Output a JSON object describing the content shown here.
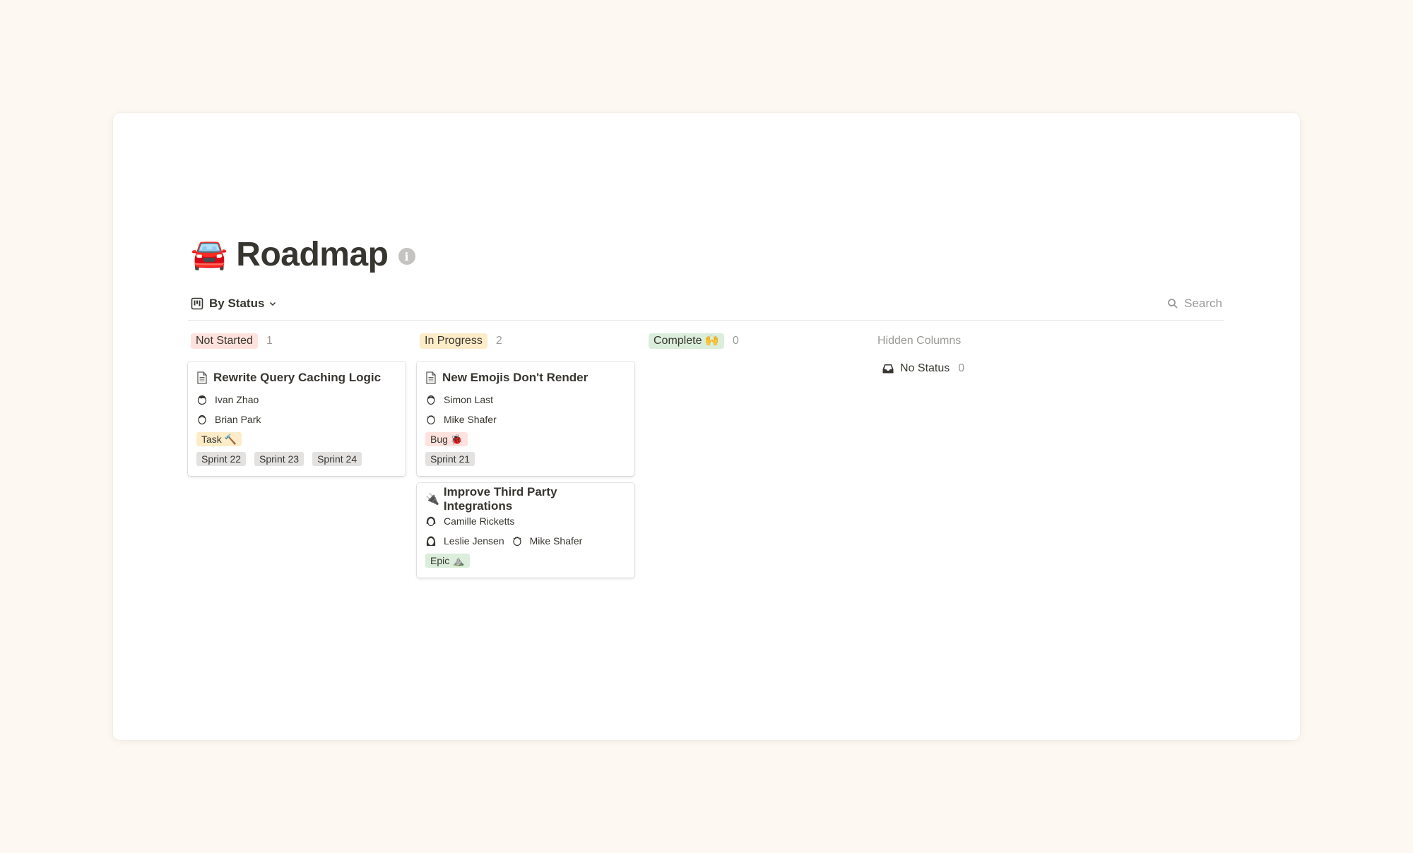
{
  "page": {
    "emoji": "🚘",
    "title": "Roadmap",
    "info_icon": "i"
  },
  "toolbar": {
    "view_icon": "board-icon",
    "view_label": "By Status",
    "search_label": "Search"
  },
  "columns": [
    {
      "label": "Not Started",
      "count": "1",
      "color": "#ffe2dd",
      "cards": [
        {
          "icon": "document-icon",
          "title": "Rewrite Query Caching Logic",
          "people": [
            [
              "Ivan Zhao"
            ],
            [
              "Brian Park"
            ]
          ],
          "type_tag": {
            "label": "Task 🔨",
            "color": "#fdecc8"
          },
          "sprints": [
            "Sprint 22",
            "Sprint 23",
            "Sprint 24"
          ]
        }
      ]
    },
    {
      "label": "In Progress",
      "count": "2",
      "color": "#fdecc8",
      "cards": [
        {
          "icon": "document-icon",
          "title": "New Emojis Don't Render",
          "people": [
            [
              "Simon Last"
            ],
            [
              "Mike Shafer"
            ]
          ],
          "type_tag": {
            "label": "Bug 🐞",
            "color": "#ffe2dd"
          },
          "sprints": [
            "Sprint 21"
          ]
        },
        {
          "icon": "plug-icon",
          "title": "Improve Third Party Integrations",
          "people": [
            [
              "Camille Ricketts"
            ],
            [
              "Leslie Jensen",
              "Mike Shafer"
            ]
          ],
          "type_tag": {
            "label": "Epic ⛰️",
            "color": "#dbeddb"
          },
          "sprints": []
        }
      ]
    },
    {
      "label": "Complete 🙌",
      "count": "0",
      "color": "#dbeddb",
      "cards": []
    }
  ],
  "hidden": {
    "title": "Hidden Columns",
    "items": [
      {
        "icon": "inbox-icon",
        "label": "No Status",
        "count": "0"
      }
    ]
  },
  "colors": {
    "sprint_tag": "#e3e2e0",
    "background": "#fdf8f2"
  },
  "plug_glyph": "🔌"
}
